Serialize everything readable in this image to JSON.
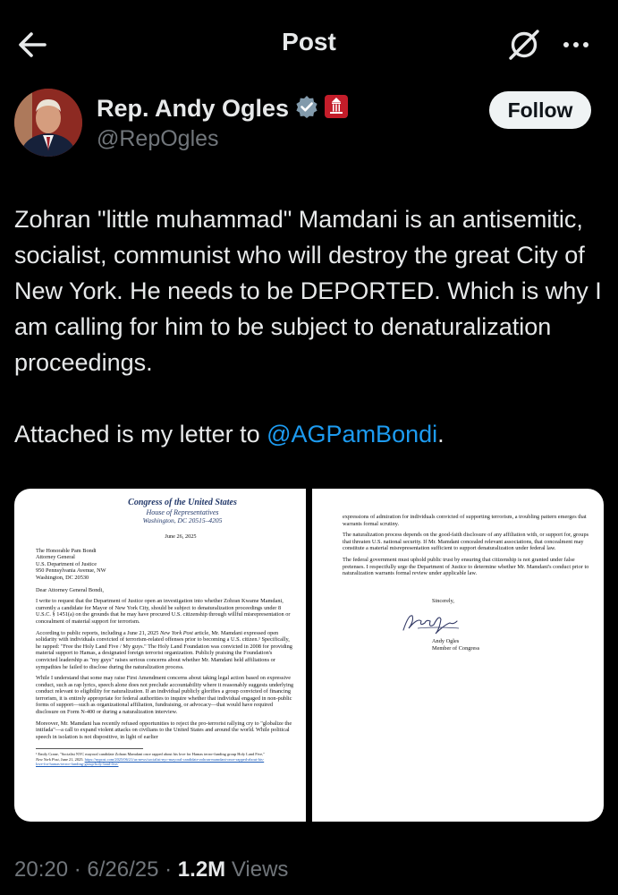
{
  "header": {
    "title": "Post"
  },
  "author": {
    "name": "Rep. Andy Ogles",
    "handle": "@RepOgles",
    "follow_label": "Follow"
  },
  "tweet": {
    "line1_part1": "Zohran \"little muhammad\" Mamdani is an antisemitic, socialist, communist who will destroy the great City of New York. He needs to be DEPORTED. Which is why I am calling for him to be subject to denaturalization proceedings.",
    "line2_prefix": "Attached is my letter to ",
    "mention": "@AGPamBondi",
    "line2_suffix": "."
  },
  "letter": {
    "letterhead": [
      "Congress of the United States",
      "House of Representatives",
      "Washington, DC 20515–4205"
    ],
    "date": "June 26, 2025",
    "address": [
      "The Honorable Pam Bondi",
      "Attorney General",
      "U.S. Department of Justice",
      "950 Pennsylvania Avenue, NW",
      "Washington, DC 20530"
    ],
    "salutation": "Dear Attorney General Bondi,",
    "p1": "I write to request that the Department of Justice open an investigation into whether Zohran Kwame Mamdani, currently a candidate for Mayor of New York City, should be subject to denaturalization proceedings under 8 U.S.C. § 1451(a) on the grounds that he may have procured U.S. citizenship through willful misrepresentation or concealment of material support for terrorism.",
    "p2_pre": "According to public reports, including a June 21, 2025 ",
    "p2_italic": "New York Post",
    "p2_post": " article, Mr. Mamdani expressed open solidarity with individuals convicted of terrorism-related offenses prior to becoming a U.S. citizen.¹ Specifically, he rapped: \"Free the Holy Land Five / My guys.\" The Holy Land Foundation was convicted in 2008 for providing material support to Hamas, a designated foreign terrorist organization. Publicly praising the Foundation's convicted leadership as \"my guys\" raises serious concerns about whether Mr. Mamdani held affiliations or sympathies he failed to disclose during the naturalization process.",
    "p3": "While I understand that some may raise First Amendment concerns about taking legal action based on expressive conduct, such as rap lyrics, speech alone does not preclude accountability where it reasonably suggests underlying conduct relevant to eligibility for naturalization. If an individual publicly glorifies a group convicted of financing terrorism, it is entirely appropriate for federal authorities to inquire whether that individual engaged in non-public forms of support—such as organizational affiliation, fundraising, or advocacy—that would have required disclosure on Form N-400 or during a naturalization interview.",
    "p4": "Moreover, Mr. Mamdani has recently refused opportunities to reject the pro-terrorist rallying cry to \"globalize the intifada\"—a call to expand violent attacks on civilians to the United States and around the world. While political speech in isolation is not dispositive, in light of earlier",
    "footnote_pre": "¹ Emily Crane, \"Socialist NYC mayoral candidate Zohran Mamdani once rapped about his love for Hamas terror-funding group Holy Land Five,\" ",
    "footnote_italic": "New York Post",
    "footnote_post": ", June 21, 2025. ",
    "footnote_link": "https://nypost.com/2025/06/21/us-news/socialist-nyc-mayoral-candidate-zohran-mamdani-once-rapped-about-his-love-for-hamas-terror-funding-group-holy-land-five/",
    "page2_p1": "expressions of admiration for individuals convicted of supporting terrorism, a troubling pattern emerges that warrants formal scrutiny.",
    "page2_p2": "The naturalization process depends on the good-faith disclosure of any affiliation with, or support for, groups that threaten U.S. national security. If Mr. Mamdani concealed relevant associations, that concealment may constitute a material misrepresentation sufficient to support denaturalization under federal law.",
    "page2_p3": "The federal government must uphold public trust by ensuring that citizenship is not granted under false pretenses. I respectfully urge the Department of Justice to determine whether Mr. Mamdani's conduct prior to naturalization warrants formal review under applicable law.",
    "closing": "Sincerely,",
    "signer": "Andy Ogles",
    "signer_title": "Member of Congress"
  },
  "meta": {
    "time": "20:20",
    "sep1": " · ",
    "date": "6/26/25",
    "sep2": " · ",
    "views": "1.2M",
    "views_label": " Views"
  },
  "colors": {
    "background": "#000000",
    "accent": "#1d9bf0",
    "verified": "#829aab",
    "secondary_text": "#71767b"
  },
  "icons": [
    "back-arrow-icon",
    "grok-icon",
    "more-icon",
    "verified-badge-icon",
    "house-seal-icon",
    "signature"
  ]
}
